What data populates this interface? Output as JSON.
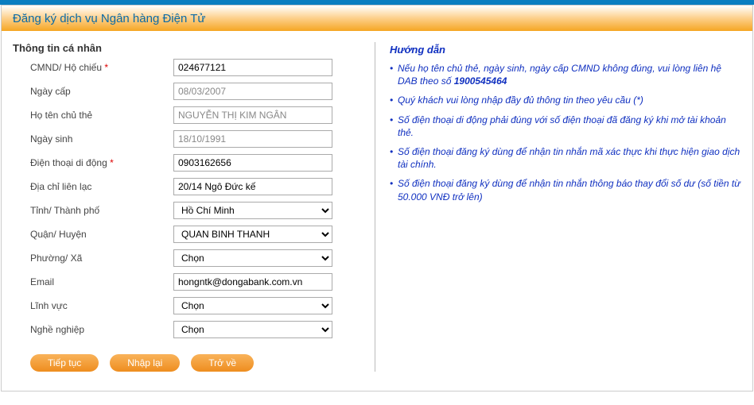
{
  "header": {
    "title": "Đăng ký dịch vụ Ngân hàng Điện Tử"
  },
  "section_title": "Thông tin cá nhân",
  "form": {
    "cmnd_label": "CMND/ Hộ chiếu",
    "cmnd_value": "024677121",
    "ngaycap_label": "Ngày cấp",
    "ngaycap_value": "08/03/2007",
    "hoten_label": "Họ tên chủ thẻ",
    "hoten_value": "NGUYỄN THỊ KIM NGÂN",
    "ngaysinh_label": "Ngày sinh",
    "ngaysinh_value": "18/10/1991",
    "dtdd_label": "Điện thoại di động",
    "dtdd_value": "0903162656",
    "diachi_label": "Địa chỉ liên lạc",
    "diachi_value": "20/14 Ngô Đức kế",
    "tinh_label": "Tỉnh/ Thành phố",
    "tinh_value": "Hồ Chí Minh",
    "quan_label": "Quận/ Huyện",
    "quan_value": "QUAN BINH THANH",
    "phuong_label": "Phường/ Xã",
    "phuong_value": "Chọn",
    "email_label": "Email",
    "email_value": "hongntk@dongabank.com.vn",
    "linhvuc_label": "Lĩnh vực",
    "linhvuc_value": "Chọn",
    "nghe_label": "Nghề nghiệp",
    "nghe_value": "Chọn"
  },
  "buttons": {
    "continue": "Tiếp tục",
    "reset": "Nhập lại",
    "back": "Trở về"
  },
  "guide": {
    "title": "Hướng dẫn",
    "phone": "1900545464",
    "item1a": "Nếu họ tên chủ thẻ, ngày sinh, ngày cấp CMND không đúng, vui lòng liên hệ DAB theo số ",
    "item2": "Quý khách vui lòng nhập đầy đủ thông tin theo yêu cầu (*)",
    "item3": "Số điện thoại di động phải đúng với số điện thoại đã đăng ký khi mở tài khoản thẻ.",
    "item4": "Số điện thoại đăng ký dùng để nhận tin nhắn mã xác thực khi thực hiện giao dịch tài chính.",
    "item5": "Số điện thoại đăng ký dùng để nhận tin nhắn thông báo thay đổi số dư (số tiền từ 50.000 VNĐ trở lên)"
  }
}
